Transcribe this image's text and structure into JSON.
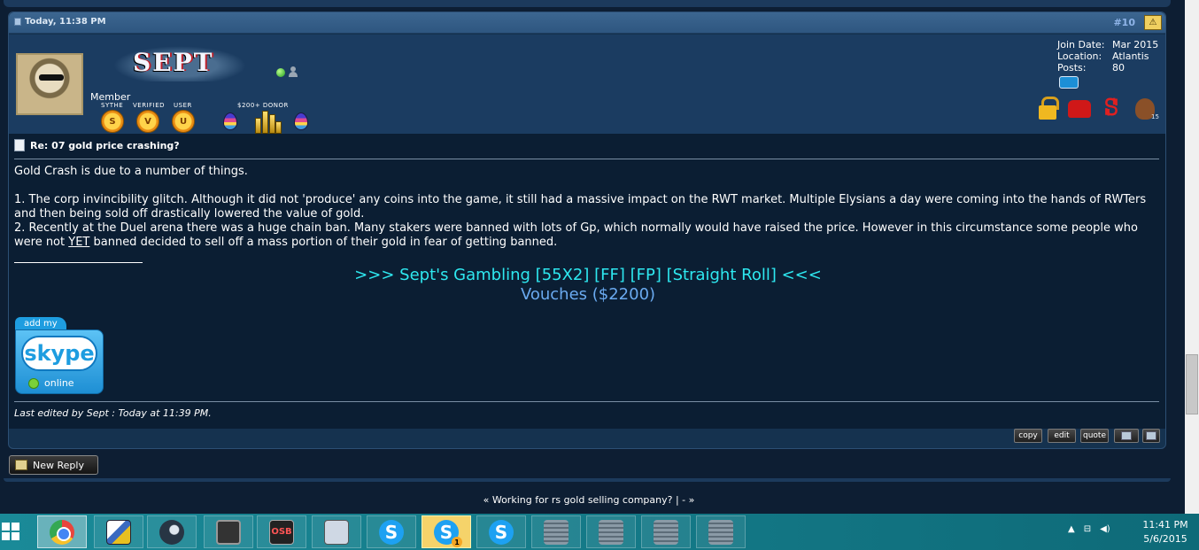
{
  "post": {
    "date": "Today, 11:38 PM",
    "number": "#10",
    "username": "SEPT",
    "user_title": "Member",
    "award_labels": {
      "sythe": "SYTHE",
      "verified": "VERIFIED",
      "user": "USER",
      "donor": "$200+ DONOR"
    },
    "badge_letters": [
      "S",
      "V",
      "U"
    ],
    "join_info": [
      {
        "key": "Join Date:",
        "value": "Mar 2015"
      },
      {
        "key": "Location:",
        "value": "Atlantis"
      },
      {
        "key": "Posts:",
        "value": "80"
      }
    ],
    "rep_count": "15",
    "title": "Re: 07 gold price crashing?",
    "body": {
      "intro": "Gold Crash is due to a number of things.",
      "p1": "1. The corp invincibility glitch. Although it did not 'produce' any coins into the game, it still had a massive impact on the RWT market. Multiple Elysians a day were coming into the hands of RWTers and then being sold off drastically lowered the value of gold.",
      "p2_before": "2. Recently at the Duel arena there was a huge chain ban. Many stakers were banned with lots of Gp, which normally would have raised the price. However in this circumstance some people who were not ",
      "p2_underlined": "YET",
      "p2_after": " banned decided to sell off a mass portion of their gold in fear of getting banned."
    },
    "signature": {
      "link1": ">>> Sept's Gambling [55X2] [FF] [FP] [Straight Roll] <<<",
      "link2": "Vouches ($2200)",
      "skype_tab": "add my",
      "skype_logo": "skype",
      "skype_status": "online"
    },
    "last_edited": "Last edited by Sept : Today at 11:39 PM.",
    "buttons": {
      "copy": "copy",
      "edit": "edit",
      "quote": "quote"
    }
  },
  "new_reply": "New Reply",
  "thread_nav": "« Working for rs gold selling company? | - »",
  "taskbar": {
    "clock_time": "11:41 PM",
    "clock_date": "5/6/2015",
    "osb_label": "OSB",
    "skype_notification": "1"
  },
  "colors": {
    "sig_link1": "#2ee8f0",
    "sig_link2": "#6aaaf0",
    "post_number": "#8fb4e8"
  }
}
